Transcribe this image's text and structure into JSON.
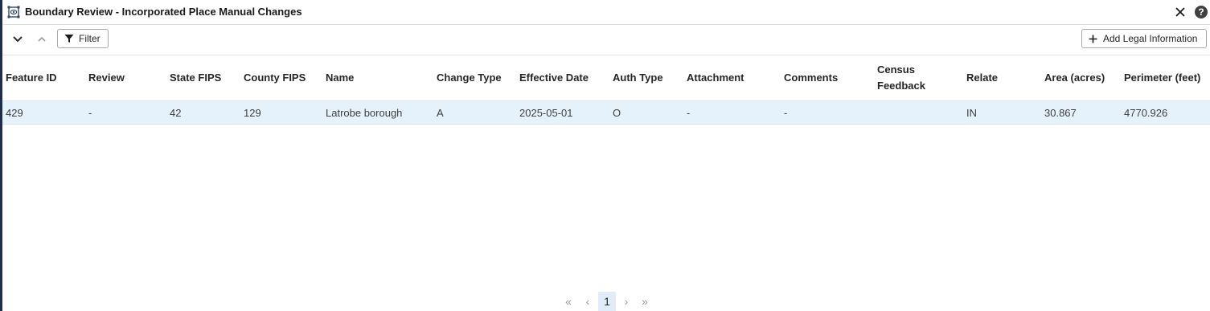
{
  "window": {
    "title": "Boundary Review - Incorporated Place Manual Changes",
    "icons": {
      "app": "boundary-review-icon",
      "close": "close-icon",
      "help": "help-icon"
    },
    "help_label": "?"
  },
  "toolbar": {
    "filter_label": "Filter",
    "add_legal_label": "Add Legal Information",
    "icons": [
      "chevron-down-icon",
      "chevron-up-icon",
      "filter-icon",
      "plus-icon"
    ]
  },
  "table": {
    "columns": {
      "feature_id": "Feature ID",
      "review": "Review",
      "state_fips": "State FIPS",
      "county_fips": "County FIPS",
      "name": "Name",
      "change_type": "Change Type",
      "effective_date": "Effective Date",
      "auth_type": "Auth Type",
      "attachment": "Attachment",
      "comments": "Comments",
      "census_feedback_1": "Census",
      "census_feedback_2": "Feedback",
      "relate": "Relate",
      "area": "Area (acres)",
      "perimeter": "Perimeter (feet)"
    },
    "rows": [
      {
        "feature_id": "429",
        "review": "-",
        "state_fips": "42",
        "county_fips": "129",
        "name": "Latrobe borough",
        "change_type": "A",
        "effective_date": "2025-05-01",
        "auth_type": "O",
        "attachment": "-",
        "comments": "-",
        "census_feedback": "",
        "relate": "IN",
        "area": "30.867",
        "perimeter": "4770.926"
      }
    ],
    "selected_row_color": "#e5f1fb"
  },
  "pager": {
    "first": "«",
    "prev": "‹",
    "current_page": "1",
    "next": "›",
    "last": "»"
  }
}
